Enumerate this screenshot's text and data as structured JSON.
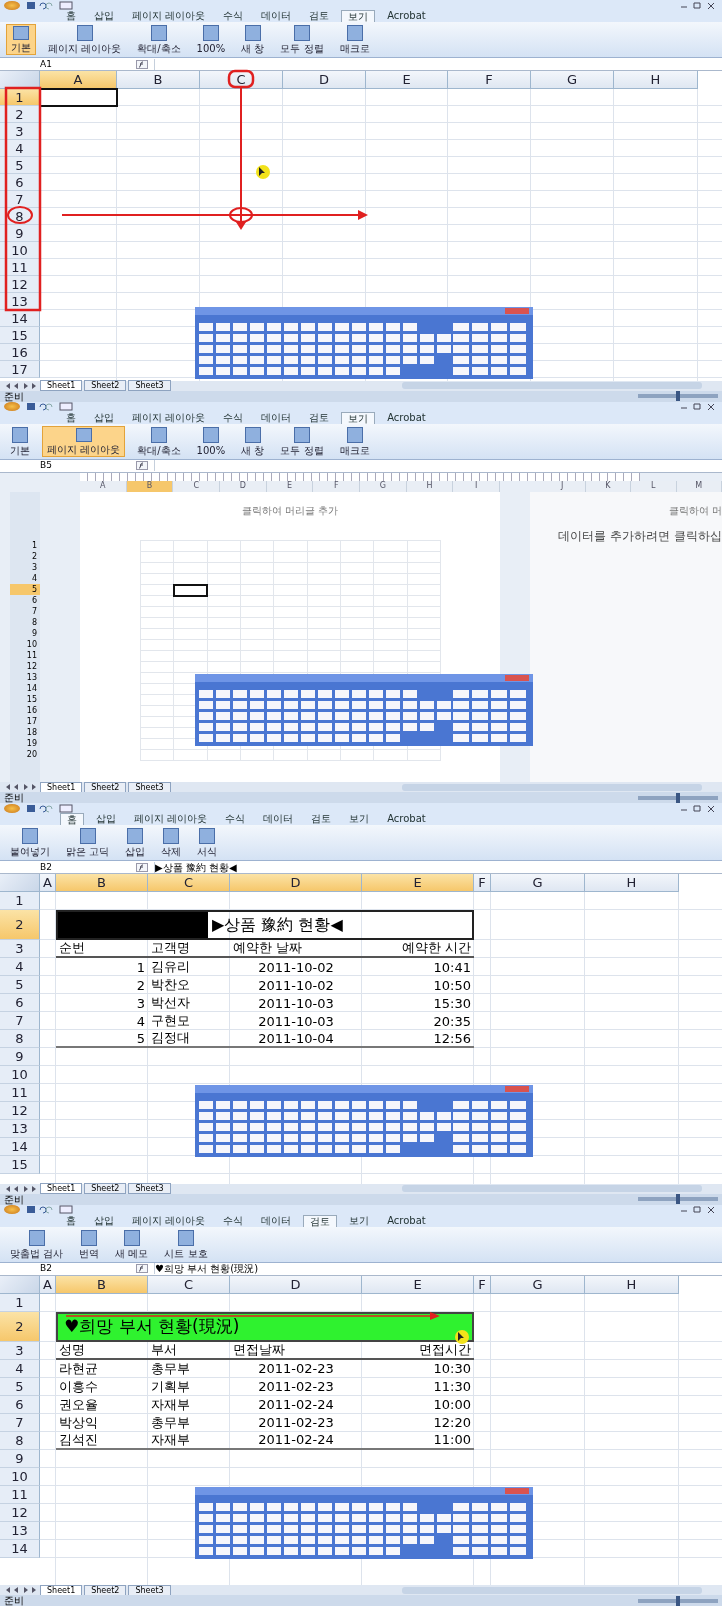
{
  "panels": [
    {
      "kind": "annotated-sheet",
      "tabs": [
        {
          "label": "홈",
          "selected": false
        },
        {
          "label": "삽입",
          "selected": false
        },
        {
          "label": "페이지 레이아웃",
          "selected": false
        },
        {
          "label": "수식",
          "selected": false
        },
        {
          "label": "데이터",
          "selected": false
        },
        {
          "label": "검토",
          "selected": false
        },
        {
          "label": "보기",
          "selected": true
        },
        {
          "label": "Acrobat",
          "selected": false
        }
      ],
      "ribbon": [
        {
          "label": "기본",
          "selected": true
        },
        {
          "label": "페이지 레이아웃",
          "selected": false
        },
        {
          "label": "확대/축소",
          "selected": false
        },
        {
          "label": "100%",
          "selected": false
        },
        {
          "label": "새 창",
          "selected": false
        },
        {
          "label": "모두 정렬",
          "selected": false
        },
        {
          "label": "매크로",
          "selected": false
        }
      ],
      "name_box": "A1",
      "columns": [
        {
          "label": "A",
          "selected": true
        },
        {
          "label": "B",
          "selected": false
        },
        {
          "label": "C",
          "selected": false
        },
        {
          "label": "D",
          "selected": false
        },
        {
          "label": "E",
          "selected": false
        },
        {
          "label": "F",
          "selected": false
        },
        {
          "label": "G",
          "selected": false
        },
        {
          "label": "H",
          "selected": false
        }
      ],
      "rows": [
        {
          "label": "1",
          "selected": true
        },
        {
          "label": "2",
          "selected": false
        },
        {
          "label": "3",
          "selected": false
        },
        {
          "label": "4",
          "selected": false
        },
        {
          "label": "5",
          "selected": false
        },
        {
          "label": "6",
          "selected": false
        },
        {
          "label": "7",
          "selected": false
        },
        {
          "label": "8",
          "selected": false
        },
        {
          "label": "9",
          "selected": false
        },
        {
          "label": "10",
          "selected": false
        },
        {
          "label": "11",
          "selected": false
        },
        {
          "label": "12",
          "selected": false
        },
        {
          "label": "13",
          "selected": false
        },
        {
          "label": "14",
          "selected": false
        },
        {
          "label": "15",
          "selected": false
        },
        {
          "label": "16",
          "selected": false
        },
        {
          "label": "17",
          "selected": false
        }
      ],
      "annotations": [
        {
          "kind": "row-box"
        },
        {
          "kind": "column-circle"
        },
        {
          "kind": "row-circle"
        },
        {
          "kind": "down-arrow"
        },
        {
          "kind": "cross-circle"
        },
        {
          "kind": "right-arrow"
        },
        {
          "kind": "mouse-cursor"
        }
      ],
      "sheets": [
        {
          "label": "Sheet1",
          "selected": true
        },
        {
          "label": "Sheet2",
          "selected": false
        },
        {
          "label": "Sheet3",
          "selected": false
        }
      ],
      "status": "준비",
      "zoom_slider": {
        "level": 0.5
      }
    },
    {
      "kind": "page-layout",
      "tabs": [
        {
          "label": "홈",
          "selected": false
        },
        {
          "label": "삽입",
          "selected": false
        },
        {
          "label": "페이지 레이아웃",
          "selected": false
        },
        {
          "label": "수식",
          "selected": false
        },
        {
          "label": "데이터",
          "selected": false
        },
        {
          "label": "검토",
          "selected": false
        },
        {
          "label": "보기",
          "selected": true
        },
        {
          "label": "Acrobat",
          "selected": false
        }
      ],
      "ribbon": [
        {
          "label": "기본",
          "selected": false
        },
        {
          "label": "페이지 레이아웃",
          "selected": true
        },
        {
          "label": "확대/축소",
          "selected": false
        },
        {
          "label": "100%",
          "selected": false
        },
        {
          "label": "새 창",
          "selected": false
        },
        {
          "label": "모두 정렬",
          "selected": false
        },
        {
          "label": "매크로",
          "selected": false
        }
      ],
      "name_box": "B5",
      "columns": [
        {
          "label": "A",
          "selected": false
        },
        {
          "label": "B",
          "selected": true
        },
        {
          "label": "C",
          "selected": false
        },
        {
          "label": "D",
          "selected": false
        },
        {
          "label": "E",
          "selected": false
        },
        {
          "label": "F",
          "selected": false
        },
        {
          "label": "G",
          "selected": false
        },
        {
          "label": "H",
          "selected": false
        },
        {
          "label": "I",
          "selected": false
        }
      ],
      "side_columns": [
        "J",
        "K",
        "L",
        "M"
      ],
      "header_hint": "클릭하여 머리글 추가",
      "side_hint": "클릭하여 머",
      "side_text": "데이터를 추가하려면 클릭하십",
      "rows": [
        {
          "label": "1",
          "selected": false
        },
        {
          "label": "2",
          "selected": false
        },
        {
          "label": "3",
          "selected": false
        },
        {
          "label": "4",
          "selected": false
        },
        {
          "label": "5",
          "selected": true
        },
        {
          "label": "6",
          "selected": false
        },
        {
          "label": "7",
          "selected": false
        },
        {
          "label": "8",
          "selected": false
        },
        {
          "label": "9",
          "selected": false
        },
        {
          "label": "10",
          "selected": false
        },
        {
          "label": "11",
          "selected": false
        },
        {
          "label": "12",
          "selected": false
        },
        {
          "label": "13",
          "selected": false
        },
        {
          "label": "14",
          "selected": false
        },
        {
          "label": "15",
          "selected": false
        },
        {
          "label": "16",
          "selected": false
        },
        {
          "label": "17",
          "selected": false
        },
        {
          "label": "18",
          "selected": false
        },
        {
          "label": "19",
          "selected": false
        },
        {
          "label": "20",
          "selected": false
        }
      ],
      "sheets": [
        {
          "label": "Sheet1",
          "selected": true
        },
        {
          "label": "Sheet2",
          "selected": false
        },
        {
          "label": "Sheet3",
          "selected": false
        }
      ],
      "status": "준비",
      "zoom_slider": {
        "level": 0.5
      }
    },
    {
      "kind": "table-sheet",
      "tabs": [
        {
          "label": "홈",
          "selected": true
        },
        {
          "label": "삽입",
          "selected": false
        },
        {
          "label": "페이지 레이아웃",
          "selected": false
        },
        {
          "label": "수식",
          "selected": false
        },
        {
          "label": "데이터",
          "selected": false
        },
        {
          "label": "검토",
          "selected": false
        },
        {
          "label": "보기",
          "selected": false
        },
        {
          "label": "Acrobat",
          "selected": false
        }
      ],
      "ribbon": [
        {
          "label": "붙여넣기",
          "selected": false
        },
        {
          "label": "맑은 고딕",
          "selected": false
        },
        {
          "label": "삽입",
          "selected": false
        },
        {
          "label": "삭제",
          "selected": false
        },
        {
          "label": "서식",
          "selected": false
        }
      ],
      "name_box": "B2",
      "formula": "▶상품 豫約 현황◀",
      "columns": [
        {
          "label": "A",
          "selected": false
        },
        {
          "label": "B",
          "selected": true
        },
        {
          "label": "C",
          "selected": true
        },
        {
          "label": "D",
          "selected": true
        },
        {
          "label": "E",
          "selected": true
        },
        {
          "label": "F",
          "selected": false
        },
        {
          "label": "G",
          "selected": false
        },
        {
          "label": "H",
          "selected": false
        }
      ],
      "rows": [
        {
          "label": "1",
          "selected": false
        },
        {
          "label": "2",
          "selected": true
        },
        {
          "label": "3",
          "selected": false
        },
        {
          "label": "4",
          "selected": false
        },
        {
          "label": "5",
          "selected": false
        },
        {
          "label": "6",
          "selected": false
        },
        {
          "label": "7",
          "selected": false
        },
        {
          "label": "8",
          "selected": false
        },
        {
          "label": "9",
          "selected": false
        },
        {
          "label": "10",
          "selected": false
        },
        {
          "label": "11",
          "selected": false
        },
        {
          "label": "12",
          "selected": false
        },
        {
          "label": "13",
          "selected": false
        },
        {
          "label": "14",
          "selected": false
        },
        {
          "label": "15",
          "selected": false
        }
      ],
      "table": {
        "title": {
          "kind": "marker",
          "text": "▶상품 豫約 현황◀"
        },
        "columns": [
          {
            "kind": "number",
            "header": "순번"
          },
          {
            "kind": "text",
            "header": "고객명"
          },
          {
            "kind": "date",
            "header": "예약한 날짜"
          },
          {
            "kind": "time",
            "header": "예약한 시간"
          }
        ],
        "rows": [
          [
            "1",
            "김유리",
            "2011-10-02",
            "10:41"
          ],
          [
            "2",
            "박찬오",
            "2011-10-02",
            "10:50"
          ],
          [
            "3",
            "박선자",
            "2011-10-03",
            "15:30"
          ],
          [
            "4",
            "구현모",
            "2011-10-03",
            "20:35"
          ],
          [
            "5",
            "김정대",
            "2011-10-04",
            "12:56"
          ]
        ]
      },
      "sheets": [
        {
          "label": "Sheet1",
          "selected": true
        },
        {
          "label": "Sheet2",
          "selected": false
        },
        {
          "label": "Sheet3",
          "selected": false
        }
      ],
      "status": "준비",
      "zoom_slider": {
        "level": 0.5
      }
    },
    {
      "kind": "table-sheet",
      "tabs": [
        {
          "label": "홈",
          "selected": false
        },
        {
          "label": "삽입",
          "selected": false
        },
        {
          "label": "페이지 레이아웃",
          "selected": false
        },
        {
          "label": "수식",
          "selected": false
        },
        {
          "label": "데이터",
          "selected": false
        },
        {
          "label": "검토",
          "selected": true
        },
        {
          "label": "보기",
          "selected": false
        },
        {
          "label": "Acrobat",
          "selected": false
        }
      ],
      "ribbon": [
        {
          "label": "맞춤법 검사",
          "selected": false
        },
        {
          "label": "번역",
          "selected": false
        },
        {
          "label": "새 메모",
          "selected": false
        },
        {
          "label": "시트 보호",
          "selected": false
        }
      ],
      "name_box": "B2",
      "formula": "♥희망 부서 현황(現況)",
      "columns": [
        {
          "label": "A",
          "selected": false
        },
        {
          "label": "B",
          "selected": true
        },
        {
          "label": "C",
          "selected": false
        },
        {
          "label": "D",
          "selected": false
        },
        {
          "label": "E",
          "selected": false
        },
        {
          "label": "F",
          "selected": false
        },
        {
          "label": "G",
          "selected": false
        },
        {
          "label": "H",
          "selected": false
        }
      ],
      "rows": [
        {
          "label": "1",
          "selected": false
        },
        {
          "label": "2",
          "selected": true
        },
        {
          "label": "3",
          "selected": false
        },
        {
          "label": "4",
          "selected": false
        },
        {
          "label": "5",
          "selected": false
        },
        {
          "label": "6",
          "selected": false
        },
        {
          "label": "7",
          "selected": false
        },
        {
          "label": "8",
          "selected": false
        },
        {
          "label": "9",
          "selected": false
        },
        {
          "label": "10",
          "selected": false
        },
        {
          "label": "11",
          "selected": false
        },
        {
          "label": "12",
          "selected": false
        },
        {
          "label": "13",
          "selected": false
        },
        {
          "label": "14",
          "selected": false
        }
      ],
      "table": {
        "title": {
          "kind": "highlight",
          "text": "♥희망 부서 현황(現況)"
        },
        "columns": [
          {
            "kind": "text",
            "header": "성명"
          },
          {
            "kind": "text",
            "header": "부서"
          },
          {
            "kind": "date",
            "header": "면접날짜"
          },
          {
            "kind": "time",
            "header": "면접시간"
          }
        ],
        "rows": [
          [
            "라현균",
            "총무부",
            "2011-02-23",
            "10:30"
          ],
          [
            "이흥수",
            "기획부",
            "2011-02-23",
            "11:30"
          ],
          [
            "권오율",
            "자재부",
            "2011-02-24",
            "10:00"
          ],
          [
            "박상익",
            "총무부",
            "2011-02-23",
            "12:20"
          ],
          [
            "김석진",
            "자재부",
            "2011-02-24",
            "11:00"
          ]
        ]
      },
      "annotations": [
        {
          "kind": "title-arrow"
        },
        {
          "kind": "mouse-cursor"
        }
      ],
      "sheets": [
        {
          "label": "Sheet1",
          "selected": true
        },
        {
          "label": "Sheet2",
          "selected": false
        },
        {
          "label": "Sheet3",
          "selected": false
        }
      ],
      "status": "준비",
      "zoom_slider": {
        "level": 0.5
      }
    }
  ]
}
